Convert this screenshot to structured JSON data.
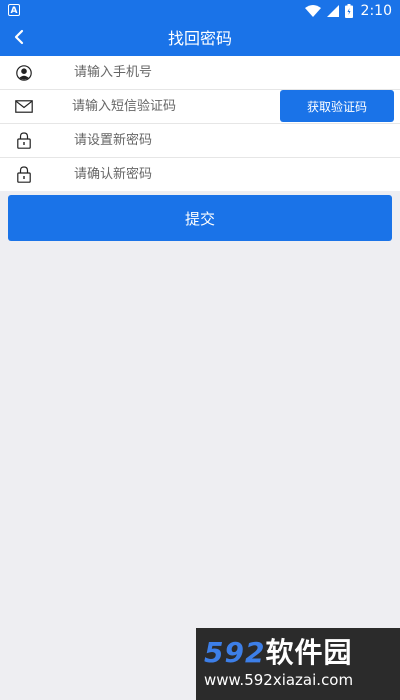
{
  "status_bar": {
    "left_icon": "A",
    "time": "2:10",
    "icons": [
      "wifi-icon",
      "signal-icon",
      "battery-icon"
    ]
  },
  "app_bar": {
    "back_icon": "back-chevron-icon",
    "title": "找回密码"
  },
  "form": {
    "phone": {
      "icon": "user-icon",
      "placeholder": "请输入手机号",
      "value": ""
    },
    "sms_code": {
      "icon": "mail-icon",
      "placeholder": "请输入短信验证码",
      "value": "",
      "button_label": "获取验证码"
    },
    "new_password": {
      "icon": "lock-icon",
      "placeholder": "请设置新密码",
      "value": ""
    },
    "confirm_password": {
      "icon": "lock-icon",
      "placeholder": "请确认新密码",
      "value": ""
    }
  },
  "submit_label": "提交",
  "watermark": {
    "logo_number": "592",
    "logo_text": "软件园",
    "url": "www.592xiazai.com"
  },
  "colors": {
    "primary": "#1a73e8",
    "background": "#eeeef2",
    "card": "#ffffff"
  }
}
